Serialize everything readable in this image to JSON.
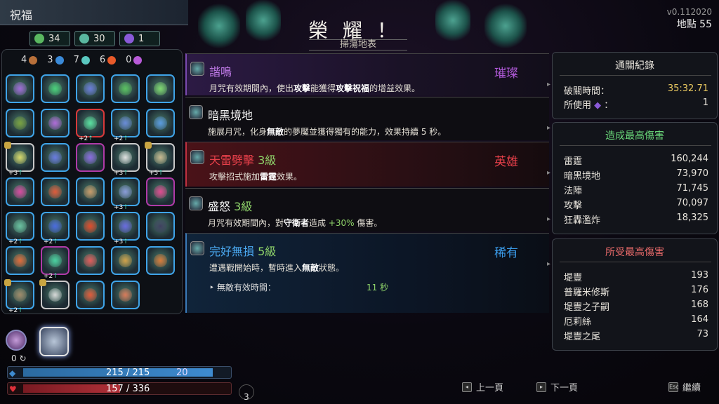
{
  "left": {
    "title": "祝福",
    "resources": [
      {
        "icon": "darkness-icon",
        "value": "34",
        "color": "#5ab860"
      },
      {
        "icon": "psyche-icon",
        "value": "30",
        "color": "#5ab8a0"
      },
      {
        "icon": "ash-icon",
        "value": "1",
        "color": "#8a5ad8"
      }
    ],
    "elements": [
      {
        "icon": "earth-icon",
        "value": "4",
        "color": "#b8703a"
      },
      {
        "icon": "water-icon",
        "value": "3",
        "color": "#3a8ad8"
      },
      {
        "icon": "air-icon",
        "value": "7",
        "color": "#5ac8c0"
      },
      {
        "icon": "fire-icon",
        "value": "6",
        "color": "#e85a2a"
      },
      {
        "icon": "aether-icon",
        "value": "0",
        "color": "#b85ad8"
      }
    ],
    "boons": [
      {
        "name": "boon-1",
        "rarity": "rare",
        "color": "#a06ad8",
        "up": ""
      },
      {
        "name": "boon-2",
        "rarity": "rare",
        "color": "#4ad07a",
        "up": ""
      },
      {
        "name": "boon-3",
        "rarity": "rare",
        "color": "#6a7ad8",
        "up": ""
      },
      {
        "name": "boon-4",
        "rarity": "rare",
        "color": "#5ac060",
        "up": ""
      },
      {
        "name": "boon-5",
        "rarity": "rare",
        "color": "#80d870",
        "up": ""
      },
      {
        "name": "boon-6",
        "rarity": "rare",
        "color": "#7aa040",
        "up": ""
      },
      {
        "name": "boon-7",
        "rarity": "rare",
        "color": "#b06ad8",
        "up": ""
      },
      {
        "name": "boon-8",
        "rarity": "heroic",
        "color": "#5ae0a0",
        "up": "+2"
      },
      {
        "name": "boon-9",
        "rarity": "rare",
        "color": "#6a8ad8",
        "up": "+2"
      },
      {
        "name": "boon-10",
        "rarity": "rare",
        "color": "#5a9ae0",
        "up": ""
      },
      {
        "name": "boon-11",
        "rarity": "common",
        "color": "#d8d86a",
        "up": "+3",
        "badge": true
      },
      {
        "name": "boon-12",
        "rarity": "rare",
        "color": "#6a7ae0",
        "up": ""
      },
      {
        "name": "boon-13",
        "rarity": "epic",
        "color": "#8a6ae0",
        "up": ""
      },
      {
        "name": "boon-14",
        "rarity": "common",
        "color": "#e0e0e0",
        "up": "+3"
      },
      {
        "name": "boon-15",
        "rarity": "common",
        "color": "#c8b890",
        "up": "+5",
        "badge": true
      },
      {
        "name": "boon-16",
        "rarity": "rare",
        "color": "#d84aa0",
        "up": ""
      },
      {
        "name": "boon-17",
        "rarity": "rare",
        "color": "#e05a3a",
        "up": ""
      },
      {
        "name": "boon-18",
        "rarity": "rare",
        "color": "#c89a6a",
        "up": ""
      },
      {
        "name": "boon-19",
        "rarity": "rare",
        "color": "#8a9ad8",
        "up": "+3"
      },
      {
        "name": "boon-20",
        "rarity": "epic",
        "color": "#e04a90",
        "up": ""
      },
      {
        "name": "boon-21",
        "rarity": "rare",
        "color": "#6ac0a0",
        "up": "+2"
      },
      {
        "name": "boon-22",
        "rarity": "rare",
        "color": "#4a6ae0",
        "up": "+2"
      },
      {
        "name": "boon-23",
        "rarity": "rare",
        "color": "#e04a2a",
        "up": ""
      },
      {
        "name": "boon-24",
        "rarity": "rare",
        "color": "#6a6ae0",
        "up": "+3"
      },
      {
        "name": "boon-25",
        "rarity": "rare",
        "color": "#404060",
        "up": ""
      },
      {
        "name": "boon-26",
        "rarity": "rare",
        "color": "#e06a3a",
        "up": ""
      },
      {
        "name": "boon-27",
        "rarity": "epic",
        "color": "#4ad0a0",
        "up": "+2"
      },
      {
        "name": "boon-28",
        "rarity": "rare",
        "color": "#e05a5a",
        "up": ""
      },
      {
        "name": "boon-29",
        "rarity": "rare",
        "color": "#d0a04a",
        "up": ""
      },
      {
        "name": "boon-30",
        "rarity": "rare",
        "color": "#d87a3a",
        "up": ""
      },
      {
        "name": "boon-31",
        "rarity": "rare",
        "color": "#a08a6a",
        "up": "+2",
        "badge": true
      },
      {
        "name": "boon-32",
        "rarity": "common",
        "color": "#d8d8d8",
        "up": "",
        "badge": true
      },
      {
        "name": "boon-33",
        "rarity": "rare",
        "color": "#e05a3a",
        "up": ""
      },
      {
        "name": "boon-34",
        "rarity": "rare",
        "color": "#d87a5a",
        "up": ""
      }
    ],
    "zero_c": "0",
    "mana": {
      "text": "215 / 215",
      "extra": "20",
      "fill": 1.0
    },
    "hp": {
      "text": "157 / 336",
      "fill": 0.467
    },
    "counter": "3"
  },
  "header": {
    "title": "榮 耀 ！",
    "subtitle": "掃蕩地表",
    "version": "v0.112020",
    "location": "地點 55"
  },
  "list": [
    {
      "name": "諧鳴",
      "level": "",
      "rarity": "璀璨",
      "rarity_color": "#b05ad8",
      "name_color": "#c07ae8",
      "desc": [
        "月咒有效期間內，使出",
        "攻擊",
        "能獲得",
        "攻擊祝福",
        "的增益效果。"
      ]
    },
    {
      "name": "暗黑境地",
      "level": "",
      "rarity": "",
      "rarity_color": "#fff",
      "name_color": "#f0f0f0",
      "desc": [
        "施展月咒，化身",
        "無敵",
        "的夢魘並獲得獨有的能力，效果持續 5 秒。",
        "",
        ""
      ]
    },
    {
      "name": "天雷劈擊",
      "level": "3級",
      "rarity": "英雄",
      "rarity_color": "#e8404a",
      "name_color": "#e8404a",
      "desc": [
        "攻擊招式施加",
        "雷霆",
        "效果。",
        "",
        ""
      ]
    },
    {
      "name": "盛怒",
      "level": "3級",
      "rarity": "",
      "rarity_color": "#fff",
      "name_color": "#f0f0f0",
      "desc": [
        "月咒有效期間內，對",
        "守衛者",
        "造成 ",
        "+30%",
        " 傷害。"
      ]
    },
    {
      "name": "完好無損",
      "level": "5級",
      "rarity": "稀有",
      "rarity_color": "#3a9ae8",
      "name_color": "#4aa8f0",
      "desc": [
        "遭遇戰開始時，暫時進入",
        "無敵",
        "狀態。",
        "",
        ""
      ],
      "sub_label": "‣ 無敵有效時間：",
      "sub_value": "11 秒"
    }
  ],
  "clear": {
    "title": "通關紀錄",
    "time_label": "破關時間：",
    "time_value": "35:32.71",
    "used_label": "所使用",
    "used_suffix": "：",
    "used_value": "1"
  },
  "dealt": {
    "title": "造成最高傷害",
    "title_color": "#6ad87a",
    "rows": [
      {
        "label": "雷霆",
        "value": "160,244"
      },
      {
        "label": "暗黑境地",
        "value": "73,970"
      },
      {
        "label": "法陣",
        "value": "71,745"
      },
      {
        "label": "攻擊",
        "value": "70,097"
      },
      {
        "label": "狂轟濫炸",
        "value": "18,325"
      }
    ]
  },
  "taken": {
    "title": "所受最高傷害",
    "title_color": "#e86a6a",
    "rows": [
      {
        "label": "堤豐",
        "value": "193"
      },
      {
        "label": "普羅米修斯",
        "value": "176"
      },
      {
        "label": "堤豐之子嗣",
        "value": "168"
      },
      {
        "label": "厄莉絲",
        "value": "164"
      },
      {
        "label": "堤豐之尾",
        "value": "73"
      }
    ]
  },
  "nav": {
    "prev": "上一頁",
    "next": "下一頁",
    "continue": "繼續",
    "esc": "Esc"
  }
}
